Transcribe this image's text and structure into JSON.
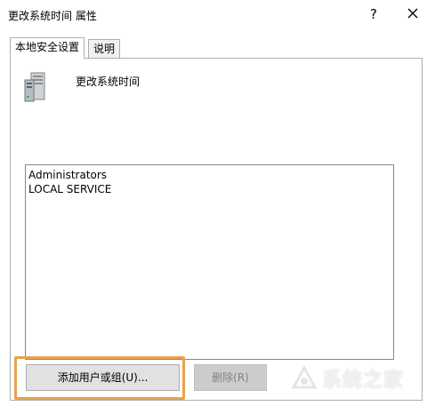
{
  "window": {
    "title": "更改系统时间 属性",
    "help_label": "?",
    "close_icon": "close-icon"
  },
  "tabs": [
    {
      "label": "本地安全设置",
      "active": true
    },
    {
      "label": "说明",
      "active": false
    }
  ],
  "policy": {
    "icon": "server-icon",
    "name": "更改系统时间"
  },
  "accounts": {
    "items": [
      "Administrators",
      "LOCAL SERVICE"
    ]
  },
  "buttons": {
    "add_label": "添加用户或组(U)...",
    "remove_label": "删除(R)",
    "remove_enabled": false
  },
  "colors": {
    "highlight": "#e8a24c",
    "button_bg": "#e1e1e1",
    "disabled_bg": "#cccccc"
  },
  "watermark": {
    "text": "系统之家",
    "icon": "watermark-logo-icon"
  }
}
